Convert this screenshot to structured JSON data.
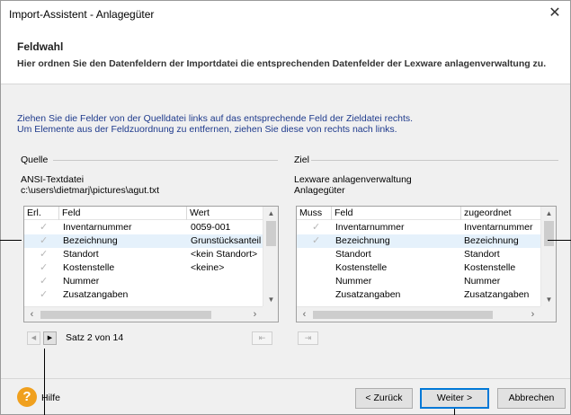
{
  "window": {
    "title": "Import-Assistent - Anlagegüter",
    "close_glyph": "✕"
  },
  "header": {
    "title": "Feldwahl",
    "subtitle": "Hier ordnen Sie den Datenfeldern der Importdatei die entsprechenden Datenfelder der Lexware anlagenverwaltung zu."
  },
  "instructions": {
    "line1": "Ziehen Sie die Felder von der Quelldatei links auf das entsprechende Feld der Zieldatei rechts.",
    "line2": "Um Elemente aus der Feldzuordnung zu entfernen, ziehen Sie diese von rechts nach links."
  },
  "source": {
    "group_label": "Quelle",
    "file_type": "ANSI-Textdatei",
    "file_path": "c:\\users\\dietmarj\\pictures\\agut.txt",
    "columns": [
      "Erl.",
      "Feld",
      "Wert"
    ],
    "rows": [
      {
        "done": "✓",
        "field": "Inventarnummer",
        "value": "0059-001",
        "selected": false
      },
      {
        "done": "✓",
        "field": "Bezeichnung",
        "value": "Grunstücksanteil I",
        "selected": true
      },
      {
        "done": "✓",
        "field": "Standort",
        "value": "<kein Standort>",
        "selected": false
      },
      {
        "done": "✓",
        "field": "Kostenstelle",
        "value": "<keine>",
        "selected": false
      },
      {
        "done": "✓",
        "field": "Nummer",
        "value": "",
        "selected": false
      },
      {
        "done": "✓",
        "field": "Zusatzangaben",
        "value": "",
        "selected": false
      }
    ]
  },
  "target": {
    "group_label": "Ziel",
    "app_name": "Lexware anlagenverwaltung",
    "entity": "Anlagegüter",
    "columns": [
      "Muss",
      "Feld",
      "zugeordnet"
    ],
    "rows": [
      {
        "required": "✓",
        "field": "Inventarnummer",
        "assigned": "Inventarnummer",
        "selected": false
      },
      {
        "required": "✓",
        "field": "Bezeichnung",
        "assigned": "Bezeichnung",
        "selected": true
      },
      {
        "required": "",
        "field": "Standort",
        "assigned": "Standort",
        "selected": false
      },
      {
        "required": "",
        "field": "Kostenstelle",
        "assigned": "Kostenstelle",
        "selected": false
      },
      {
        "required": "",
        "field": "Nummer",
        "assigned": "Nummer",
        "selected": false
      },
      {
        "required": "",
        "field": "Zusatzangaben",
        "assigned": "Zusatzangaben",
        "selected": false
      }
    ]
  },
  "record_nav": {
    "prev_glyph": "◀",
    "next_glyph": "▶",
    "status": "Satz 2 von 14"
  },
  "footer": {
    "help_glyph": "?",
    "help_label": "Hilfe",
    "back_label": "< Zurück",
    "next_label": "Weiter >",
    "cancel_label": "Abbrechen"
  },
  "colors": {
    "instruction_text": "#1e3a8c",
    "selected_row": "#e5f1fb",
    "help_icon": "#f0a01e",
    "default_button_border": "#0078d7"
  }
}
